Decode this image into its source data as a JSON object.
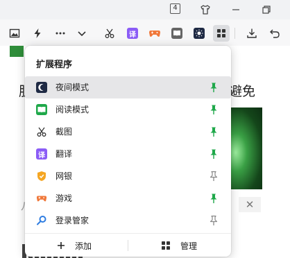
{
  "titlebar": {
    "tab_count": "4"
  },
  "popup": {
    "title": "扩展程序",
    "extensions": [
      {
        "label": "夜间模式",
        "icon": "night-mode-icon",
        "pinned": true
      },
      {
        "label": "阅读模式",
        "icon": "read-mode-icon",
        "pinned": true
      },
      {
        "label": "截图",
        "icon": "scissors-icon",
        "pinned": true
      },
      {
        "label": "翻译",
        "icon": "translate-icon",
        "icon_text": "译",
        "pinned": true
      },
      {
        "label": "网银",
        "icon": "bank-shield-icon",
        "pinned": false
      },
      {
        "label": "游戏",
        "icon": "gamepad-icon",
        "pinned": true
      },
      {
        "label": "登录管家",
        "icon": "login-key-icon",
        "pinned": false
      }
    ],
    "footer": {
      "add_label": "添加",
      "manage_label": "管理"
    }
  },
  "background_page": {
    "text_left": "肌",
    "text_right": "避免",
    "letter": "八"
  },
  "colors": {
    "pin_active": "#1fa84a",
    "pin_inactive": "#888888",
    "translate_purple": "#8b5cf6",
    "game_orange": "#f0783a",
    "read_green": "#1fa84a",
    "night_navy": "#1f2a44"
  }
}
